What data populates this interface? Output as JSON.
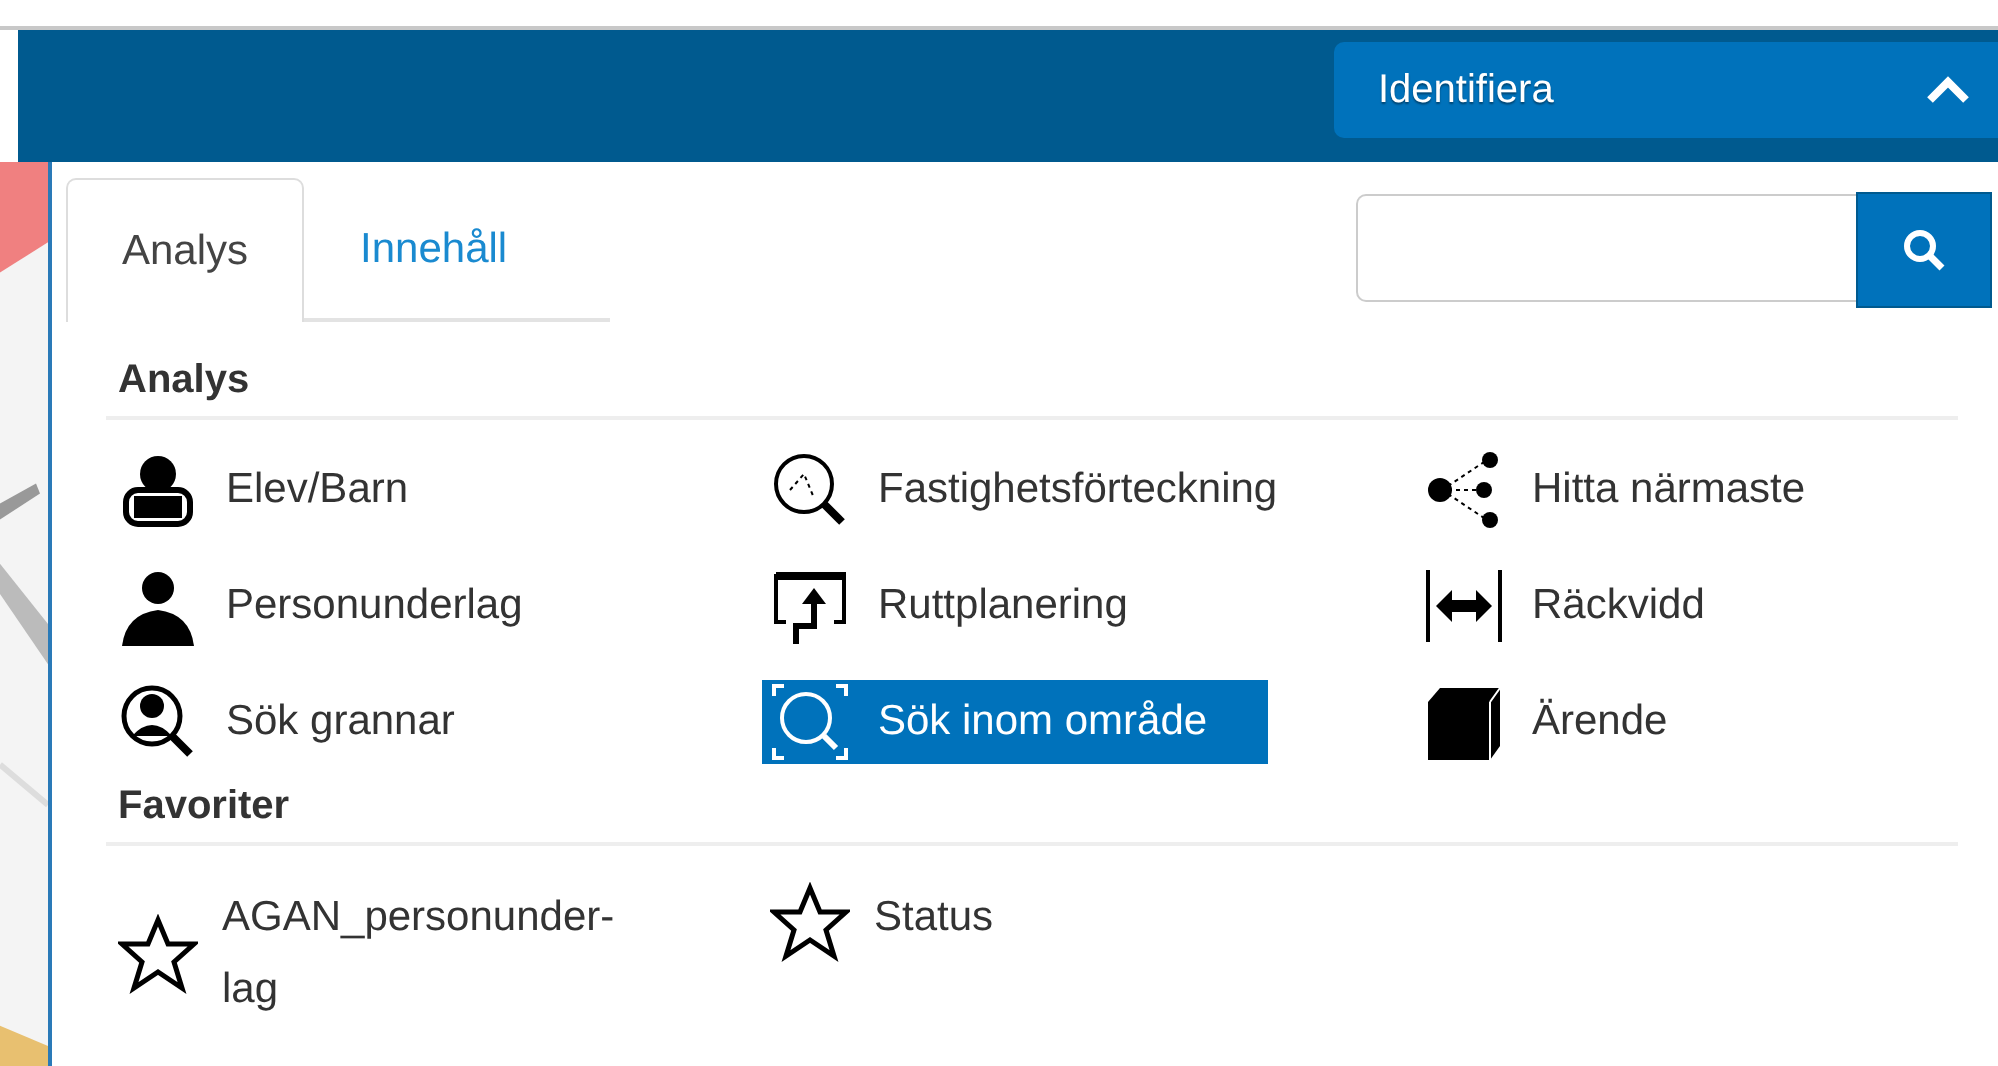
{
  "header": {
    "dropdown": {
      "label": "Identifiera",
      "expanded": true
    }
  },
  "tabs": [
    {
      "label": "Analys",
      "selected": true
    },
    {
      "label": "Innehåll",
      "selected": false
    }
  ],
  "sections": [
    {
      "title": "Analys",
      "items": [
        {
          "label": "Elev/Barn",
          "selected": false
        },
        {
          "label": "Fastighetsförteckning",
          "selected": false
        },
        {
          "label": "Hitta närmaste",
          "selected": false
        },
        {
          "label": "Personunderlag",
          "selected": false
        },
        {
          "label": "Ruttplanering",
          "selected": false
        },
        {
          "label": "Räckvidd",
          "selected": false
        },
        {
          "label": "Sök grannar",
          "selected": false
        },
        {
          "label": "Sök inom område",
          "selected": true
        },
        {
          "label": "Ärende",
          "selected": false
        }
      ]
    },
    {
      "title": "Favoriter",
      "items": [
        {
          "label": "AGAN_personunder-lag",
          "selected": false
        },
        {
          "label": "Status",
          "selected": false
        }
      ]
    }
  ]
}
